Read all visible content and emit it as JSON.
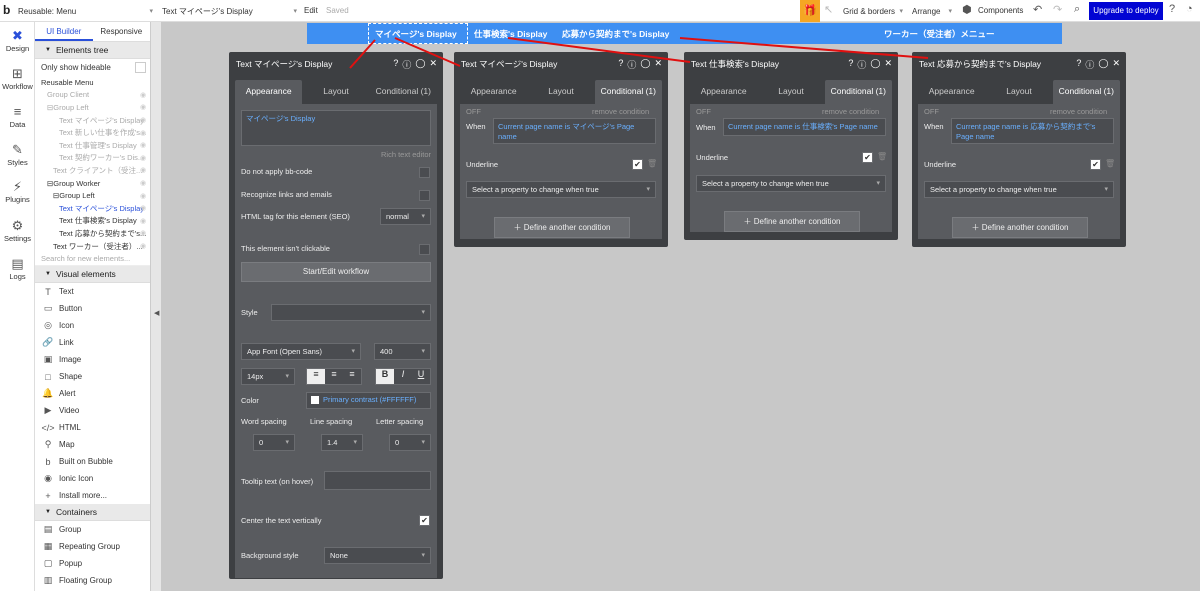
{
  "topbar": {
    "logo": "b",
    "page_select": "Reusable: Menu",
    "element_select": "Text マイページ's Display",
    "edit": "Edit",
    "saved": "Saved",
    "grid_borders": "Grid & borders",
    "arrange": "Arrange",
    "components": "Components",
    "upgrade": "Upgrade to deploy"
  },
  "sidebar": {
    "items": [
      {
        "label": "Design",
        "icon": "design-icon"
      },
      {
        "label": "Workflow",
        "icon": "workflow-icon"
      },
      {
        "label": "Data",
        "icon": "data-icon"
      },
      {
        "label": "Styles",
        "icon": "styles-icon"
      },
      {
        "label": "Plugins",
        "icon": "plugins-icon"
      },
      {
        "label": "Settings",
        "icon": "settings-icon"
      },
      {
        "label": "Logs",
        "icon": "logs-icon"
      }
    ]
  },
  "panel": {
    "tab_builder": "UI Builder",
    "tab_responsive": "Responsive",
    "elements_tree": "Elements tree",
    "only_hideable": "Only show hideable",
    "tree": [
      {
        "label": "Reusable Menu",
        "indent": 0,
        "tone": "dark"
      },
      {
        "label": "Group Client",
        "indent": 1,
        "tone": "gray"
      },
      {
        "label": "⊟Group Left",
        "indent": 1,
        "tone": "gray"
      },
      {
        "label": "Text マイページ's Display",
        "indent": 3,
        "tone": "gray"
      },
      {
        "label": "Text 新しい仕事を作成's...",
        "indent": 3,
        "tone": "gray"
      },
      {
        "label": "Text 仕事管理's Display",
        "indent": 3,
        "tone": "gray"
      },
      {
        "label": "Text 契約ワーカー's Dis...",
        "indent": 3,
        "tone": "gray"
      },
      {
        "label": "Text クライアント（受注...",
        "indent": 2,
        "tone": "gray"
      },
      {
        "label": "⊟Group Worker",
        "indent": 1,
        "tone": "dark"
      },
      {
        "label": "⊟Group Left",
        "indent": 2,
        "tone": "dark"
      },
      {
        "label": "Text マイページ's Display",
        "indent": 3,
        "tone": "blue"
      },
      {
        "label": "Text 仕事検索's Display",
        "indent": 3,
        "tone": "dark"
      },
      {
        "label": "Text 応募から契約まで's...",
        "indent": 3,
        "tone": "dark"
      },
      {
        "label": "Text ワーカー（受注者）...",
        "indent": 2,
        "tone": "dark"
      }
    ],
    "search_placeholder": "Search for new elements...",
    "visual_elements": "Visual elements",
    "visual_items": [
      {
        "label": "Text",
        "icon": "T"
      },
      {
        "label": "Button",
        "icon": "▭"
      },
      {
        "label": "Icon",
        "icon": "◎"
      },
      {
        "label": "Link",
        "icon": "🔗"
      },
      {
        "label": "Image",
        "icon": "▣"
      },
      {
        "label": "Shape",
        "icon": "□"
      },
      {
        "label": "Alert",
        "icon": "🔔"
      },
      {
        "label": "Video",
        "icon": "▶"
      },
      {
        "label": "HTML",
        "icon": "</>"
      },
      {
        "label": "Map",
        "icon": "⚲"
      },
      {
        "label": "Built on Bubble",
        "icon": "b"
      },
      {
        "label": "Ionic Icon",
        "icon": "◉"
      },
      {
        "label": "Install more...",
        "icon": "+"
      }
    ],
    "containers": "Containers",
    "container_items": [
      {
        "label": "Group",
        "icon": "▤"
      },
      {
        "label": "Repeating Group",
        "icon": "▦"
      },
      {
        "label": "Popup",
        "icon": "▢"
      },
      {
        "label": "Floating Group",
        "icon": "▥"
      }
    ]
  },
  "canvas": {
    "nav": [
      {
        "label": "マイページ's Display"
      },
      {
        "label": "仕事検索's Display"
      },
      {
        "label": "応募から契約まで's Display"
      },
      {
        "label": "ワーカー（受注者）メニュー"
      }
    ]
  },
  "inspector_main": {
    "title": "Text マイページ's Display",
    "tabs": [
      "Appearance",
      "Layout",
      "Conditional (1)"
    ],
    "content": "マイページ's Display",
    "rich_text": "Rich text editor",
    "no_bbcode": "Do not apply bb-code",
    "recognize_links": "Recognize links and emails",
    "html_tag_label": "HTML tag for this element (SEO)",
    "html_tag_value": "normal",
    "not_clickable": "This element isn't clickable",
    "workflow_btn": "Start/Edit workflow",
    "style_label": "Style",
    "font": "App Font (Open Sans)",
    "weight": "400",
    "size": "14px",
    "color_label": "Color",
    "color_value": "Primary contrast (#FFFFFF)",
    "word_spacing": "Word spacing",
    "line_spacing": "Line spacing",
    "letter_spacing": "Letter spacing",
    "word_val": "0",
    "line_val": "1.4",
    "letter_val": "0",
    "tooltip": "Tooltip text (on hover)",
    "center_vert": "Center the text vertically",
    "bg_style": "Background style",
    "bg_val": "None"
  },
  "inspectors": [
    {
      "title": "Text マイページ's Display",
      "condition": "Current page name is マイページ's Page name"
    },
    {
      "title": "Text 仕事検索's Display",
      "condition": "Current page name is 仕事検索's Page name"
    },
    {
      "title": "Text 応募から契約まで's Display",
      "condition": "Current page name is 応募から契約まで's Page name"
    }
  ],
  "conditional": {
    "tabs": [
      "Appearance",
      "Layout",
      "Conditional (1)"
    ],
    "off": "OFF",
    "remove": "remove condition",
    "when": "When",
    "underline": "Underline",
    "select_prop": "Select a property to change when true",
    "define": "Define another condition"
  }
}
